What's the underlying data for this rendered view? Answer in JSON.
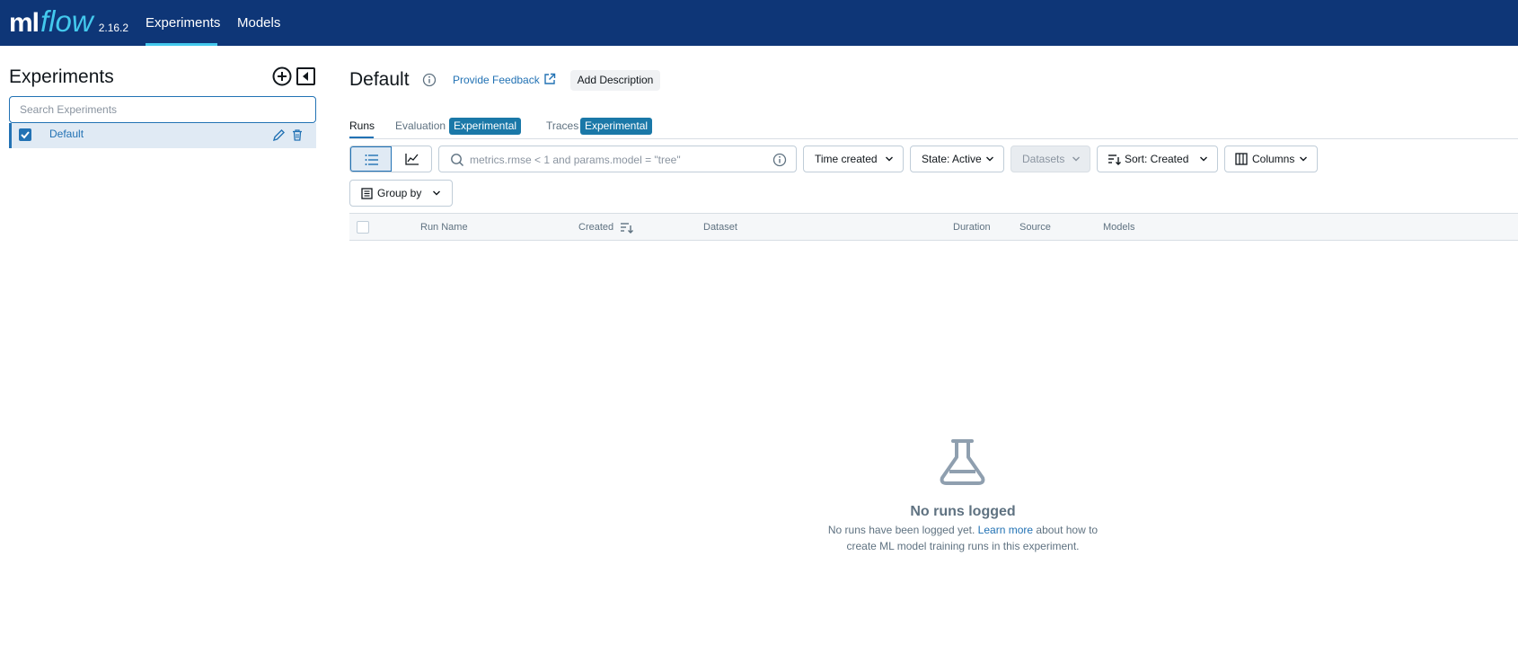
{
  "app": {
    "logo_ml": "ml",
    "logo_flow": "flow",
    "version": "2.16.2",
    "nav": [
      {
        "label": "Experiments",
        "active": true
      },
      {
        "label": "Models",
        "active": false
      }
    ]
  },
  "sidebar": {
    "title": "Experiments",
    "search_placeholder": "Search Experiments",
    "items": [
      {
        "label": "Default",
        "checked": true
      }
    ]
  },
  "header": {
    "title": "Default",
    "feedback_label": "Provide Feedback",
    "add_description_label": "Add Description"
  },
  "tabs": [
    {
      "label": "Runs",
      "active": true
    },
    {
      "label": "Evaluation",
      "badge": "Experimental"
    },
    {
      "label": "Traces",
      "badge": "Experimental"
    }
  ],
  "toolbar": {
    "filter_placeholder": "metrics.rmse < 1 and params.model = \"tree\"",
    "time_created": "Time created",
    "state": "State: Active",
    "datasets": "Datasets",
    "sort": "Sort: Created",
    "columns": "Columns",
    "group_by": "Group by"
  },
  "table": {
    "columns": [
      "Run Name",
      "Created",
      "Dataset",
      "Duration",
      "Source",
      "Models"
    ]
  },
  "empty_state": {
    "title": "No runs logged",
    "line1_before": "No runs have been logged yet.",
    "line1_link": "Learn more",
    "line1_after": "about how to",
    "line2": "create ML model training runs in this experiment."
  },
  "colors": {
    "topbar": "#0e3677",
    "accent": "#43c9ed",
    "primary": "#2272b4",
    "badge": "#1a78a8"
  }
}
